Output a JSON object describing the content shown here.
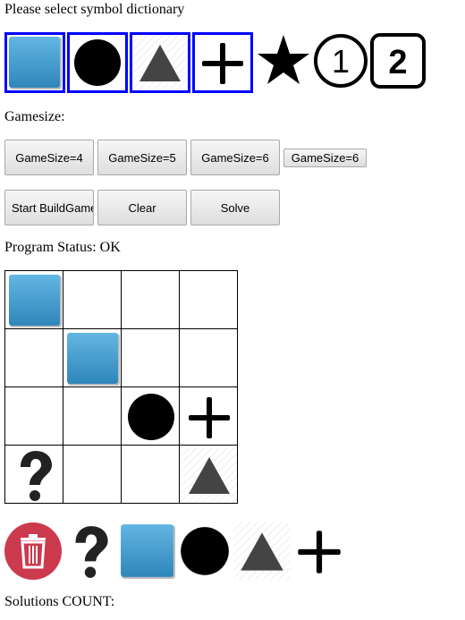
{
  "header": {
    "title": "Please select symbol dictionary",
    "gamesize_label": "Gamesize:",
    "status_label": "Program Status: OK",
    "solutions_label": "Solutions COUNT:"
  },
  "symbols": [
    {
      "name": "blue-square",
      "selected": true
    },
    {
      "name": "black-circle",
      "selected": true
    },
    {
      "name": "triangle",
      "selected": true
    },
    {
      "name": "plus",
      "selected": true
    },
    {
      "name": "star",
      "selected": false
    },
    {
      "name": "circled-1",
      "selected": false,
      "text": "1"
    },
    {
      "name": "boxed-2",
      "selected": false,
      "text": "2"
    }
  ],
  "gamesize_buttons": [
    "GameSize=4",
    "GameSize=5",
    "GameSize=6",
    "GameSize=6"
  ],
  "action_buttons": {
    "start": "Start BuildGame",
    "clear": "Clear",
    "solve": "Solve"
  },
  "board": [
    [
      "blue-square",
      "",
      "",
      ""
    ],
    [
      "",
      "blue-square",
      "",
      ""
    ],
    [
      "",
      "",
      "black-circle",
      "plus"
    ],
    [
      "question",
      "",
      "",
      "triangle"
    ]
  ],
  "palette": [
    "trash",
    "question",
    "blue-square",
    "black-circle",
    "triangle",
    "plus"
  ],
  "colors": {
    "accent_blue": "#0000ff",
    "tile_blue": "#3f9ccf",
    "trash_red": "#cc3a4e"
  }
}
